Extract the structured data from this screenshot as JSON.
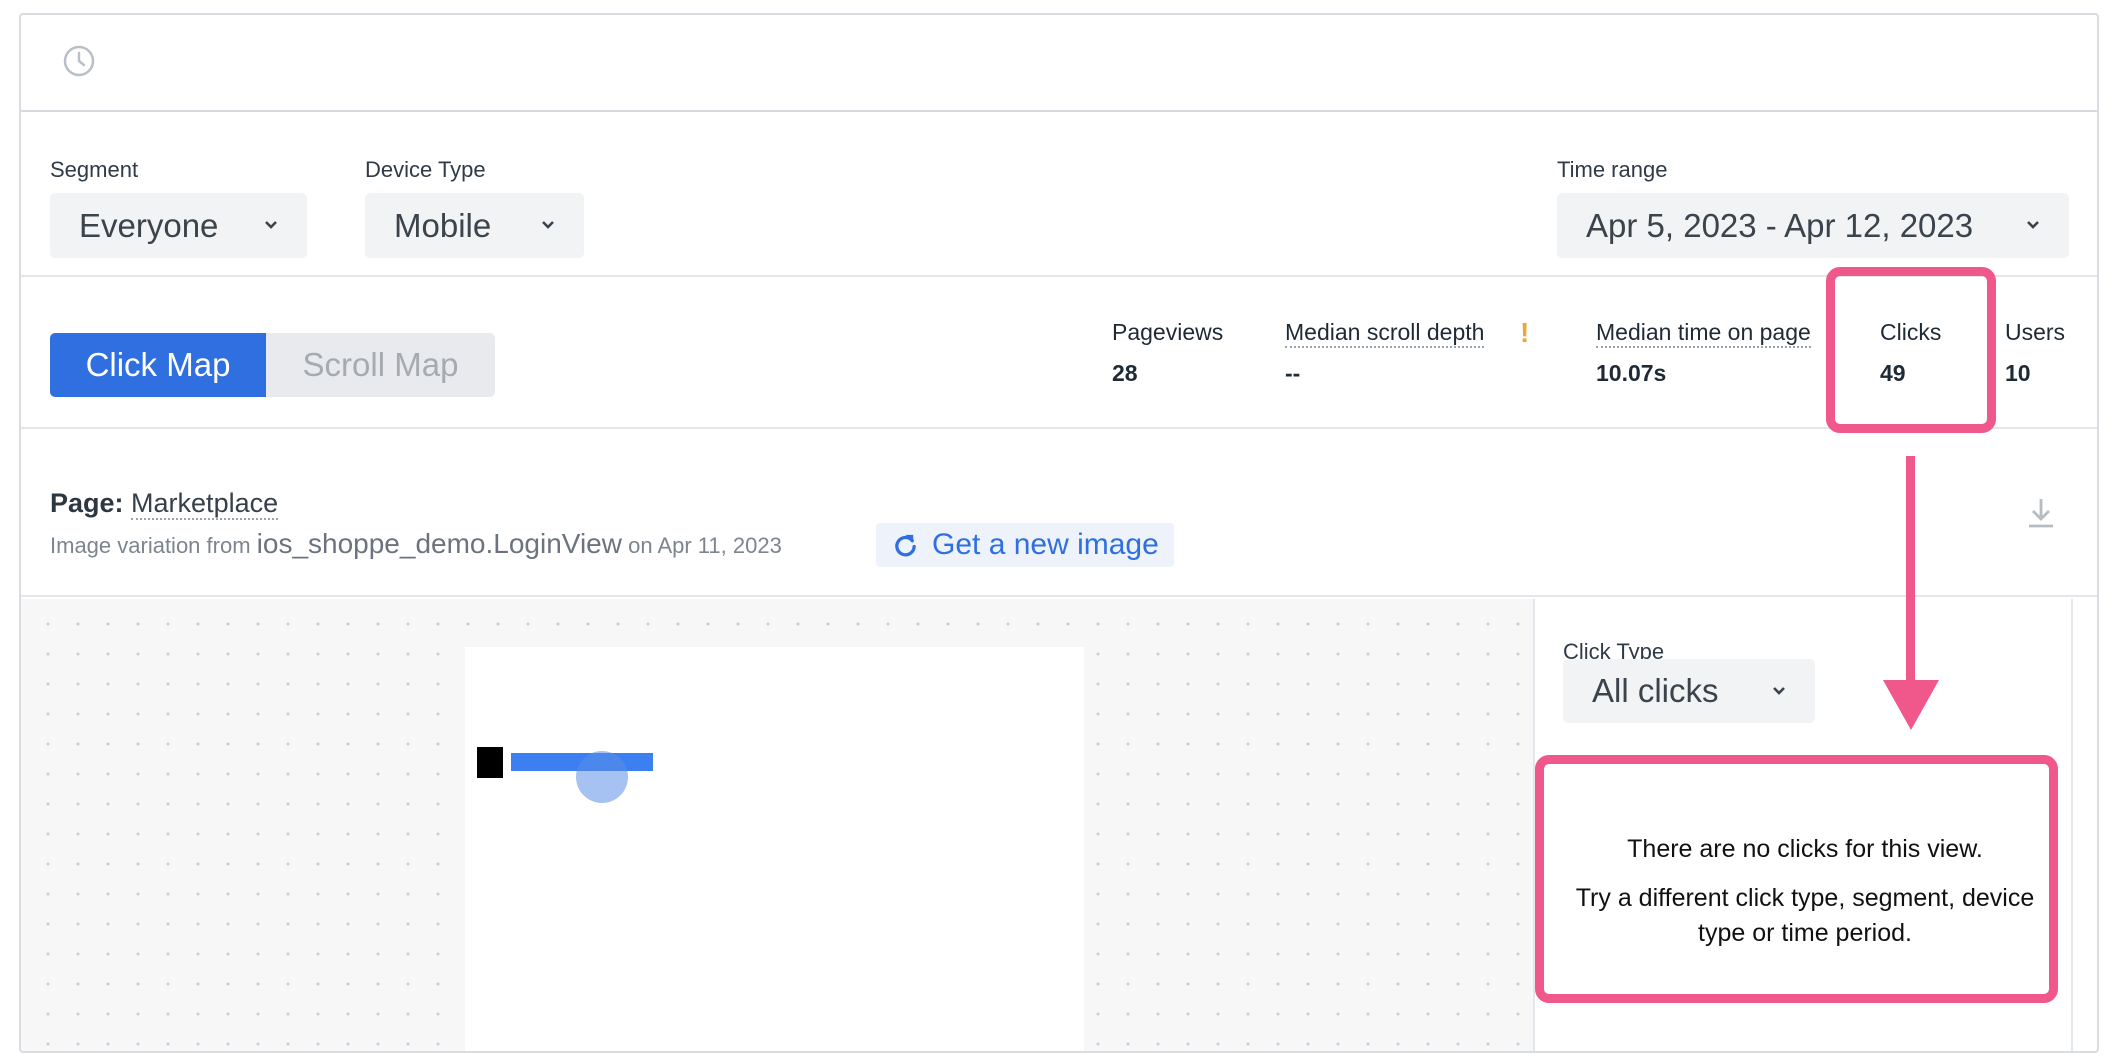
{
  "filters": {
    "segment_label": "Segment",
    "segment_value": "Everyone",
    "device_label": "Device Type",
    "device_value": "Mobile",
    "time_label": "Time range",
    "time_value": "Apr 5, 2023 - Apr 12, 2023"
  },
  "map_toggle": {
    "click_map": "Click Map",
    "scroll_map": "Scroll Map",
    "active": "Click Map"
  },
  "metrics": [
    {
      "label": "Pageviews",
      "value": "28"
    },
    {
      "label": "Median scroll depth",
      "value": "--",
      "warning": "!"
    },
    {
      "label": "Median time on page",
      "value": "10.07s"
    },
    {
      "label": "Clicks",
      "value": "49"
    },
    {
      "label": "Users",
      "value": "10"
    }
  ],
  "page": {
    "prefix": "Page:",
    "name": "Marketplace",
    "variation_prefix": "Image variation from",
    "view_name": "ios_shoppe_demo.LoginView",
    "date_text": "on Apr 11, 2023",
    "new_image_button": "Get a new image"
  },
  "click_panel": {
    "type_label": "Click Type",
    "type_value": "All clicks",
    "empty_title": "There are no clicks for this view.",
    "empty_body": "Try a different click type, segment, device type or time period."
  },
  "colors": {
    "accent_blue": "#2f6fe0",
    "highlight_pink": "#f0578a",
    "warning": "#e8a93a"
  },
  "icons": {
    "history": "clock-icon",
    "dropdown": "chevron-down-icon",
    "refresh": "refresh-icon",
    "download": "download-icon"
  }
}
